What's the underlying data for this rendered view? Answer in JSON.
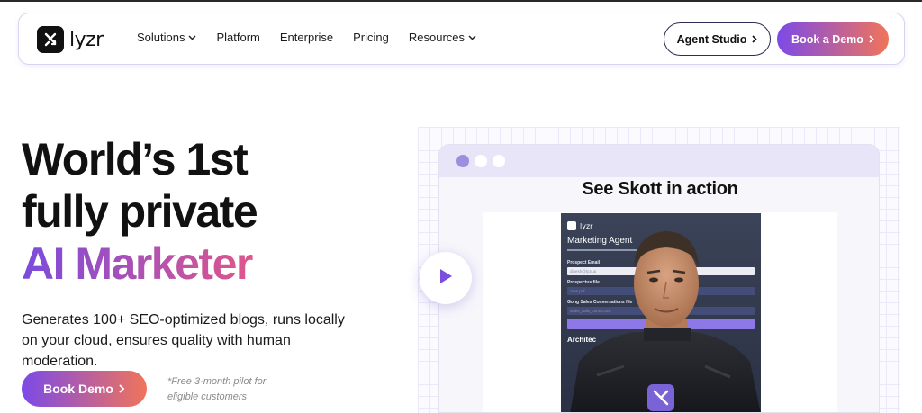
{
  "nav": {
    "logo_text": "lyzr",
    "links": [
      {
        "label": "Solutions",
        "has_dropdown": true
      },
      {
        "label": "Platform",
        "has_dropdown": false
      },
      {
        "label": "Enterprise",
        "has_dropdown": false
      },
      {
        "label": "Pricing",
        "has_dropdown": false
      },
      {
        "label": "Resources",
        "has_dropdown": true
      }
    ],
    "agent_studio_label": "Agent Studio",
    "book_demo_label": "Book a Demo"
  },
  "hero": {
    "title_line1": "World’s 1st",
    "title_line2": "fully private",
    "title_line3": "AI Marketer",
    "subtitle": "Generates 100+ SEO-optimized blogs, runs locally on your cloud, ensures quality with human moderation.",
    "cta_label": "Book Demo",
    "note": "*Free 3-month pilot for eligible customers"
  },
  "video": {
    "heading": "See Skott in action",
    "frame": {
      "logo_text": "lyzr",
      "app_title": "Marketing Agent",
      "fields": [
        {
          "label": "Prospect Email",
          "value": "dinesh@lyzr.ai"
        },
        {
          "label": "Prospectus file",
          "value": "csvs.pdf"
        },
        {
          "label": "Gong Sales Conversations file",
          "value": "sales_calls_convo.csv"
        }
      ],
      "section_heading": "Architec"
    }
  },
  "colors": {
    "accent_start": "#7c4ae8",
    "accent_end": "#f0745a",
    "title_gradient_start": "#7a4bdc",
    "title_gradient_end": "#e0578a"
  }
}
